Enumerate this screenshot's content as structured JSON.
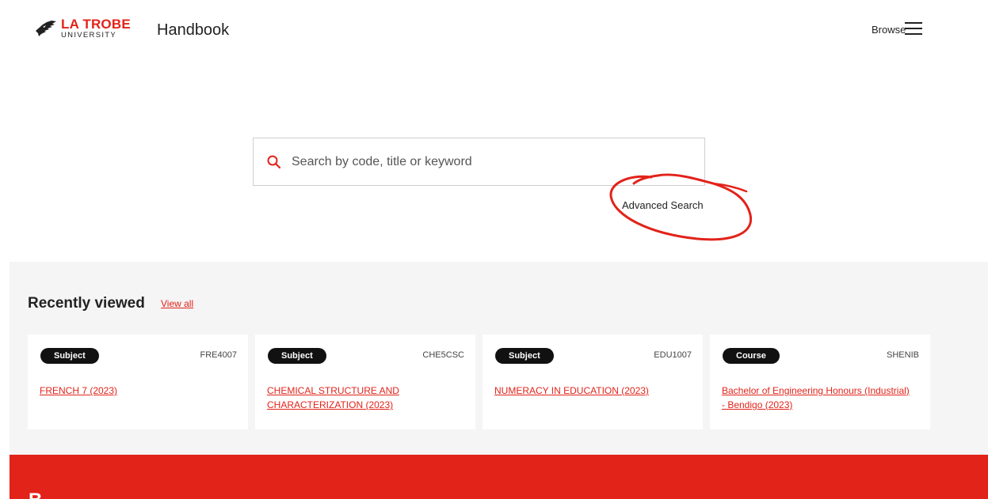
{
  "header": {
    "logo": {
      "top": "LA TROBE",
      "bottom": "UNIVERSITY"
    },
    "app_title": "Handbook",
    "browse_label": "Browse",
    "menu_icon": "hamburger-menu-icon"
  },
  "search": {
    "placeholder": "Search by code, title or keyword",
    "value": "",
    "icon": "search-icon",
    "advanced_label": "Advanced Search"
  },
  "annotation": {
    "color": "#e2231a",
    "shape": "hand-drawn circle around Advanced Search"
  },
  "recent": {
    "title": "Recently viewed",
    "view_all_label": "View all",
    "cards": [
      {
        "badge": "Subject",
        "code": "FRE4007",
        "title": "FRENCH 7 (2023)"
      },
      {
        "badge": "Subject",
        "code": "CHE5CSC",
        "title": "CHEMICAL STRUCTURE AND CHARACTERIZATION (2023)"
      },
      {
        "badge": "Subject",
        "code": "EDU1007",
        "title": "NUMERACY IN EDUCATION (2023)"
      },
      {
        "badge": "Course",
        "code": "SHENIB",
        "title": "Bachelor of Engineering Honours (Industrial) - Bendigo (2023)"
      }
    ]
  },
  "footer_band": {
    "heading": "B"
  },
  "colors": {
    "accent": "#e2231a",
    "badge_bg": "#111111",
    "section_bg": "#f5f5f5"
  }
}
